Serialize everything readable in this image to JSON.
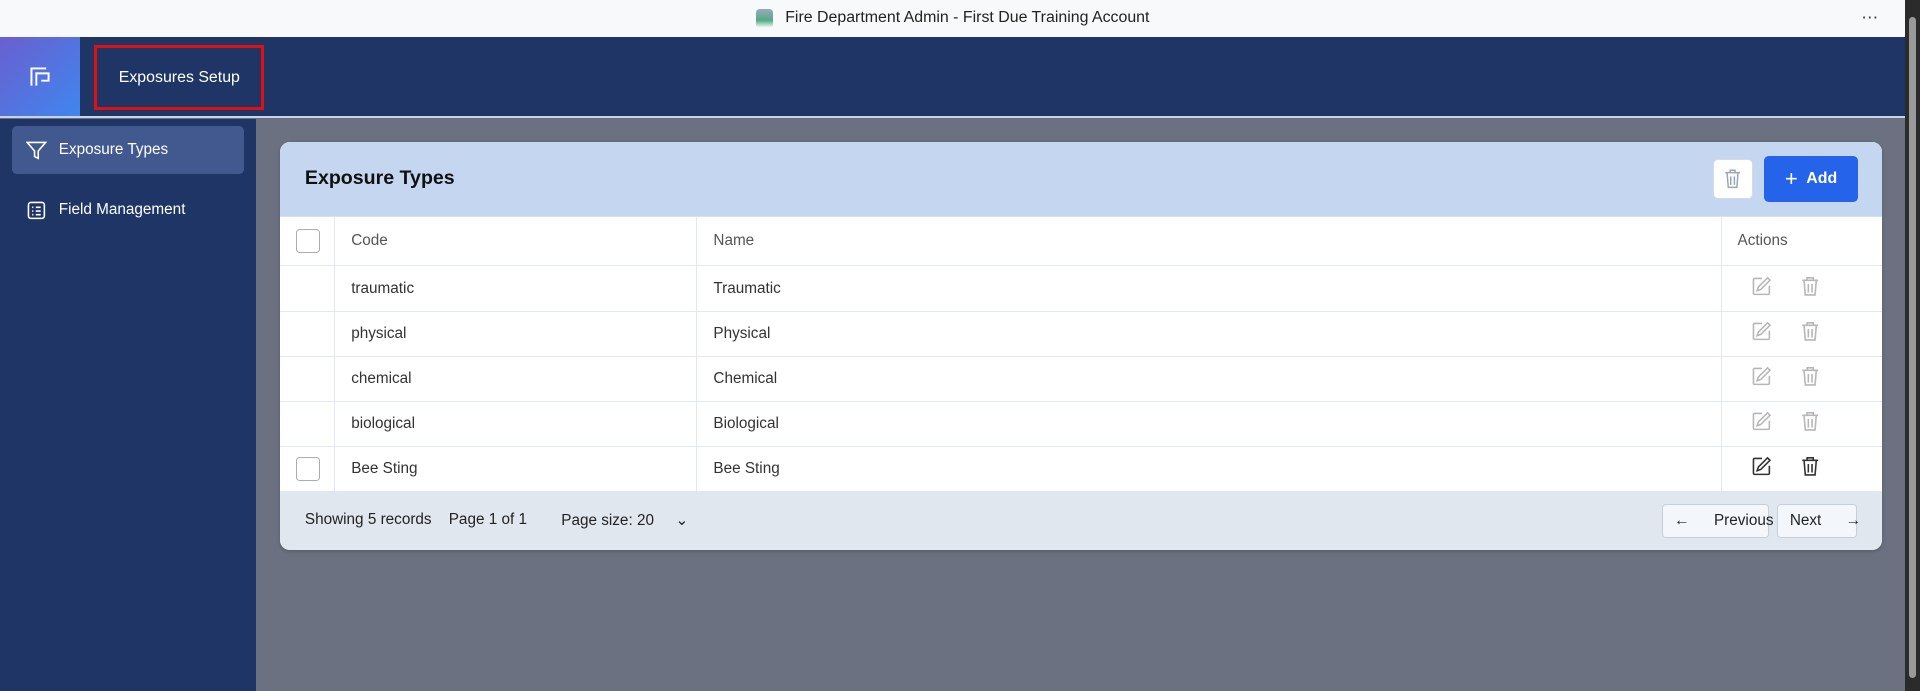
{
  "window": {
    "title": "Fire Department Admin - First Due Training Account",
    "menu": "⋯"
  },
  "header": {
    "tab": "Exposures Setup"
  },
  "sidebar": {
    "items": [
      {
        "label": "Exposure Types",
        "icon": "filter-icon",
        "active": true
      },
      {
        "label": "Field Management",
        "icon": "list-icon",
        "active": false
      }
    ]
  },
  "card": {
    "title": "Exposure Types",
    "add_label": "Add",
    "columns": {
      "code": "Code",
      "name": "Name",
      "actions": "Actions"
    },
    "rows": [
      {
        "code": "traumatic",
        "name": "Traumatic",
        "editable": false
      },
      {
        "code": "physical",
        "name": "Physical",
        "editable": false
      },
      {
        "code": "chemical",
        "name": "Chemical",
        "editable": false
      },
      {
        "code": "biological",
        "name": "Biological",
        "editable": false
      },
      {
        "code": "Bee Sting",
        "name": "Bee Sting",
        "editable": true
      }
    ]
  },
  "footer": {
    "showing": "Showing 5 records",
    "page": "Page 1 of 1",
    "page_size": "Page size: 20",
    "previous": "Previous",
    "next": "Next"
  },
  "colors": {
    "navy": "#1e3566",
    "accent": "#2563eb",
    "highlight": "#e01010"
  }
}
